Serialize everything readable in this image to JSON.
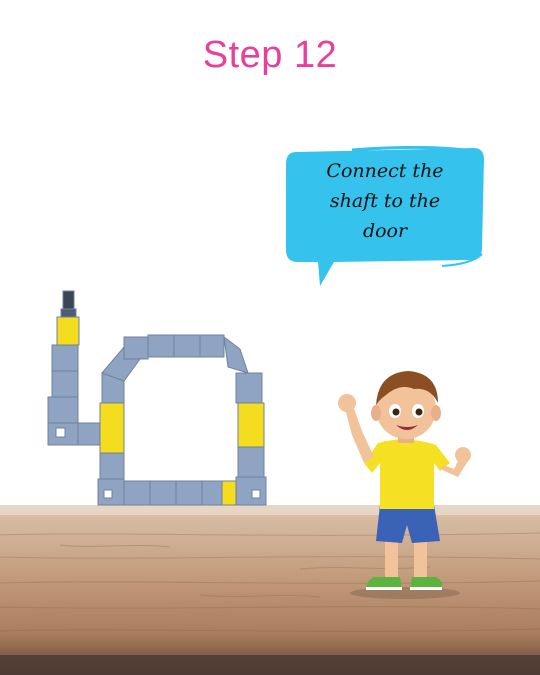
{
  "title": "Step 12",
  "speech": {
    "line1": "Connect the",
    "line2": "shaft to the",
    "line3": "door"
  },
  "colors": {
    "title": "#e8409a",
    "bubble": "#35c3ee",
    "block_blue": "#8fa4c2",
    "block_yellow": "#f4dc1e",
    "table": "#b48a6a"
  },
  "illustrations": [
    "toy-block-door-frame",
    "waving-boy",
    "wooden-table"
  ]
}
